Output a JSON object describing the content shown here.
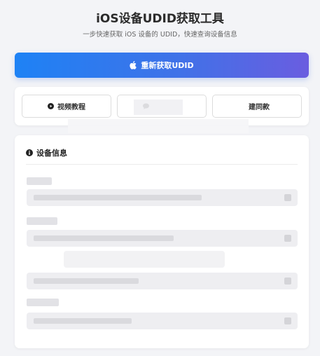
{
  "header": {
    "title": "iOS设备UDID获取工具",
    "subtitle": "一步快速获取 iOS 设备的 UDID，快速查询设备信息"
  },
  "primary_button": {
    "label": "重新获取UDID",
    "icon": "apple-icon"
  },
  "actions": [
    {
      "label": "视频教程",
      "icon": "play-circle-icon"
    },
    {
      "label": "",
      "icon": "chat-icon"
    },
    {
      "label": "建同款",
      "icon": ""
    }
  ],
  "device_info": {
    "heading": "设备信息",
    "icon": "info-circle-icon"
  },
  "colors": {
    "gradient_start": "#1e82f5",
    "gradient_end": "#6a5de0",
    "background": "#f3f4f7"
  }
}
